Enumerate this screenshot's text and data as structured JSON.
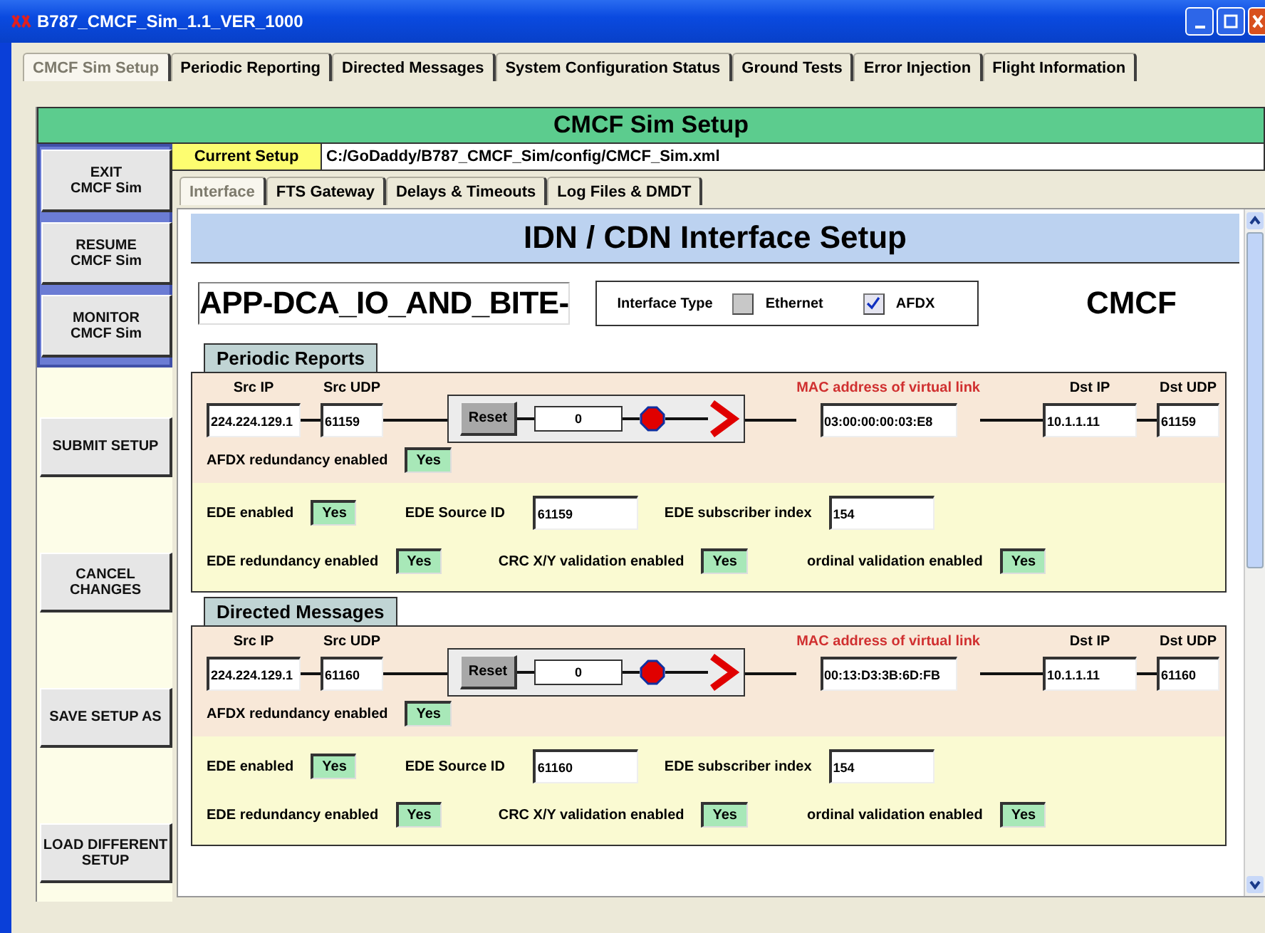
{
  "window": {
    "title": "B787_CMCF_Sim_1.1_VER_1000"
  },
  "tabs": [
    {
      "label": "CMCF Sim Setup",
      "selected": true
    },
    {
      "label": "Periodic Reporting",
      "selected": false
    },
    {
      "label": "Directed Messages",
      "selected": false
    },
    {
      "label": "System Configuration Status",
      "selected": false
    },
    {
      "label": "Ground Tests",
      "selected": false
    },
    {
      "label": "Error Injection",
      "selected": false
    },
    {
      "label": "Flight Information",
      "selected": false
    }
  ],
  "header": "CMCF Sim Setup",
  "sidebar": {
    "group": [
      "EXIT\nCMCF Sim",
      "RESUME\nCMCF Sim",
      "MONITOR\nCMCF Sim"
    ],
    "buttons": [
      "SUBMIT SETUP",
      "CANCEL\nCHANGES",
      "SAVE SETUP AS",
      "LOAD DIFFERENT\nSETUP"
    ]
  },
  "current_setup": {
    "label": "Current Setup",
    "value": "C:/GoDaddy/B787_CMCF_Sim/config/CMCF_Sim.xml"
  },
  "subtabs": [
    {
      "label": "Interface",
      "selected": true
    },
    {
      "label": "FTS Gateway",
      "selected": false
    },
    {
      "label": "Delays & Timeouts",
      "selected": false
    },
    {
      "label": "Log Files & DMDT",
      "selected": false
    }
  ],
  "panel_title": "IDN / CDN Interface Setup",
  "app_name": "APP-DCA_IO_AND_BITE-",
  "interface_type": {
    "label": "Interface Type",
    "options": [
      {
        "label": "Ethernet",
        "checked": false
      },
      {
        "label": "AFDX",
        "checked": true
      }
    ]
  },
  "system": "CMCF",
  "sections": [
    {
      "title": "Periodic Reports",
      "src_ip_label": "Src IP",
      "src_udp_label": "Src UDP",
      "mac_label": "MAC address of virtual link",
      "dst_ip_label": "Dst IP",
      "dst_udp_label": "Dst UDP",
      "src_ip": "224.224.129.1",
      "src_udp": "61159",
      "reset": "Reset",
      "counter": "0",
      "mac": "03:00:00:00:03:E8",
      "dst_ip": "10.1.1.11",
      "dst_udp": "61159",
      "afdx_label": "AFDX redundancy enabled",
      "afdx": "Yes",
      "ede_label": "EDE enabled",
      "ede": "Yes",
      "source_label": "EDE Source ID",
      "source_id": "61159",
      "subscriber_label": "EDE subscriber index",
      "subscriber": "154",
      "ede_red_label": "EDE redundancy enabled",
      "ede_red": "Yes",
      "crc_label": "CRC X/Y validation enabled",
      "crc": "Yes",
      "ordinal_label": "ordinal validation enabled",
      "ordinal": "Yes"
    },
    {
      "title": "Directed Messages",
      "src_ip_label": "Src IP",
      "src_udp_label": "Src UDP",
      "mac_label": "MAC address of virtual link",
      "dst_ip_label": "Dst IP",
      "dst_udp_label": "Dst UDP",
      "src_ip": "224.224.129.1",
      "src_udp": "61160",
      "reset": "Reset",
      "counter": "0",
      "mac": "00:13:D3:3B:6D:FB",
      "dst_ip": "10.1.1.11",
      "dst_udp": "61160",
      "afdx_label": "AFDX redundancy enabled",
      "afdx": "Yes",
      "ede_label": "EDE enabled",
      "ede": "Yes",
      "source_label": "EDE Source ID",
      "source_id": "61160",
      "subscriber_label": "EDE subscriber index",
      "subscriber": "154",
      "ede_red_label": "EDE redundancy enabled",
      "ede_red": "Yes",
      "crc_label": "CRC X/Y validation enabled",
      "crc": "Yes",
      "ordinal_label": "ordinal validation enabled",
      "ordinal": "Yes"
    }
  ]
}
